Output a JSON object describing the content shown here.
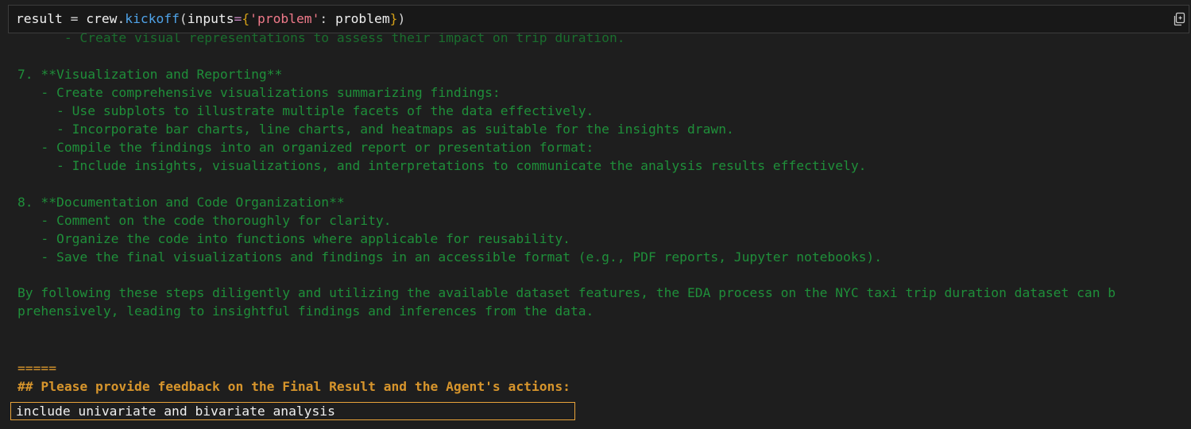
{
  "code_cell": {
    "tokens": {
      "var": "result",
      "assign": " = ",
      "obj": "crew",
      "dot": ".",
      "func": "kickoff",
      "paren_open": "(",
      "kwarg": "inputs",
      "eq": "=",
      "brace_open": "{",
      "key": "'problem'",
      "colon": ": ",
      "value": "problem",
      "brace_close": "}",
      "paren_close": ")"
    },
    "copy_icon": "copy-icon"
  },
  "output": {
    "clipped_line": "      - Create visual representations to assess their impact on trip duration.",
    "lines": [
      "7. **Visualization and Reporting**",
      "   - Create comprehensive visualizations summarizing findings:",
      "     - Use subplots to illustrate multiple facets of the data effectively.",
      "     - Incorporate bar charts, line charts, and heatmaps as suitable for the insights drawn.",
      "   - Compile the findings into an organized report or presentation format:",
      "     - Include insights, visualizations, and interpretations to communicate the analysis results effectively.",
      "",
      "8. **Documentation and Code Organization**",
      "   - Comment on the code thoroughly for clarity.",
      "   - Organize the code into functions where applicable for reusability.",
      "   - Save the final visualizations and findings in an accessible format (e.g., PDF reports, Jupyter notebooks).",
      "",
      "By following these steps diligently and utilizing the available dataset features, the EDA process on the NYC taxi trip duration dataset can b",
      "prehensively, leading to insightful findings and inferences from the data."
    ],
    "separator": "=====",
    "feedback_prompt": "## Please provide feedback on the Final Result and the Agent's actions:"
  },
  "feedback_input": {
    "value": "include univariate and bivariate analysis"
  },
  "colors": {
    "background": "#1e1e1e",
    "output_text": "#1f8f3a",
    "prompt_text": "#d7952c",
    "input_border": "#e8a33a"
  }
}
